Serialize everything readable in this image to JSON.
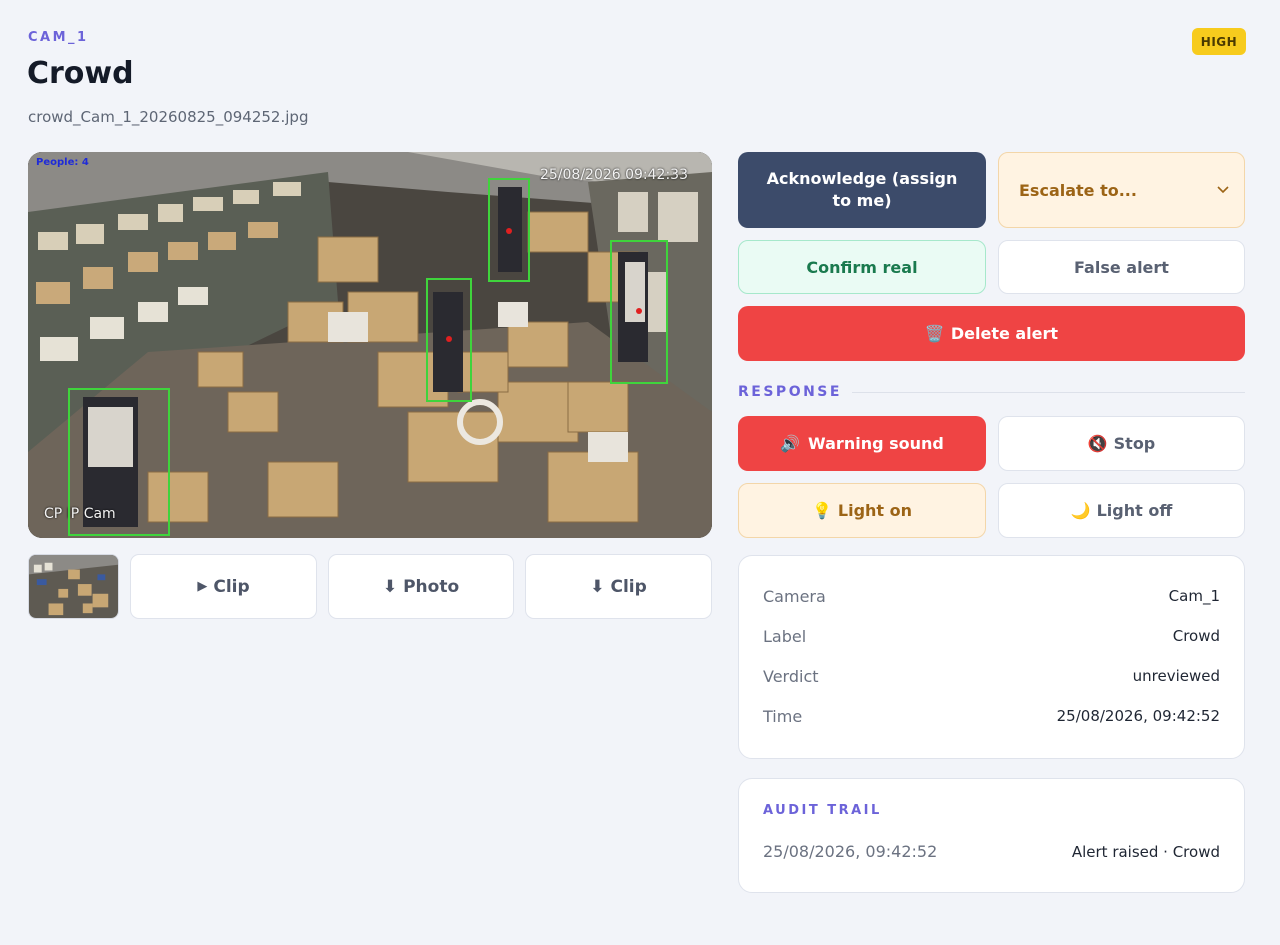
{
  "header": {
    "camera_id": "CAM_1",
    "title": "Crowd",
    "filename": "crowd_Cam_1_20260825_094252.jpg",
    "severity": "HIGH"
  },
  "snapshot": {
    "people_count": "People: 4",
    "timestamp": "25/08/2026 09:42:33",
    "camera_name": "CP IP Cam",
    "detections": 4
  },
  "media_buttons": {
    "play_clip": {
      "icon": "play-icon",
      "glyph": "▶",
      "label": "Clip"
    },
    "download_photo": {
      "icon": "download-icon",
      "glyph": "⬇",
      "label": "Photo"
    },
    "download_clip": {
      "icon": "download-icon",
      "glyph": "⬇",
      "label": "Clip"
    }
  },
  "actions": {
    "acknowledge": "Acknowledge (assign to me)",
    "escalate": {
      "selected": "Escalate to...",
      "chevron": "⌄"
    },
    "confirm": "Confirm real",
    "false_alert": "False alert",
    "delete": {
      "icon": "trash-icon",
      "glyph": "🗑️",
      "label": "Delete alert"
    }
  },
  "response": {
    "label": "RESPONSE",
    "warning_sound": {
      "icon": "speaker-icon",
      "glyph": "🔊",
      "label": "Warning sound"
    },
    "stop": {
      "icon": "mute-icon",
      "glyph": "🔇",
      "label": "Stop"
    },
    "light_on": {
      "icon": "lightbulb-icon",
      "glyph": "💡",
      "label": "Light on"
    },
    "light_off": {
      "icon": "moon-icon",
      "glyph": "🌙",
      "label": "Light off"
    }
  },
  "info": {
    "rows": [
      {
        "key": "Camera",
        "value": "Cam_1"
      },
      {
        "key": "Label",
        "value": "Crowd"
      },
      {
        "key": "Verdict",
        "value": "unreviewed"
      },
      {
        "key": "Time",
        "value": "25/08/2026, 09:42:52"
      }
    ]
  },
  "audit": {
    "title": "AUDIT TRAIL",
    "entries": [
      {
        "time": "25/08/2026, 09:42:52",
        "event": "Alert raised · Crowd"
      }
    ]
  },
  "colors": {
    "accent": "#6c63d9",
    "severity_high": "#f7cb1d",
    "danger": "#ef4444",
    "primary_dark": "#3c4b6a",
    "detection_box": "#3fd43c"
  }
}
